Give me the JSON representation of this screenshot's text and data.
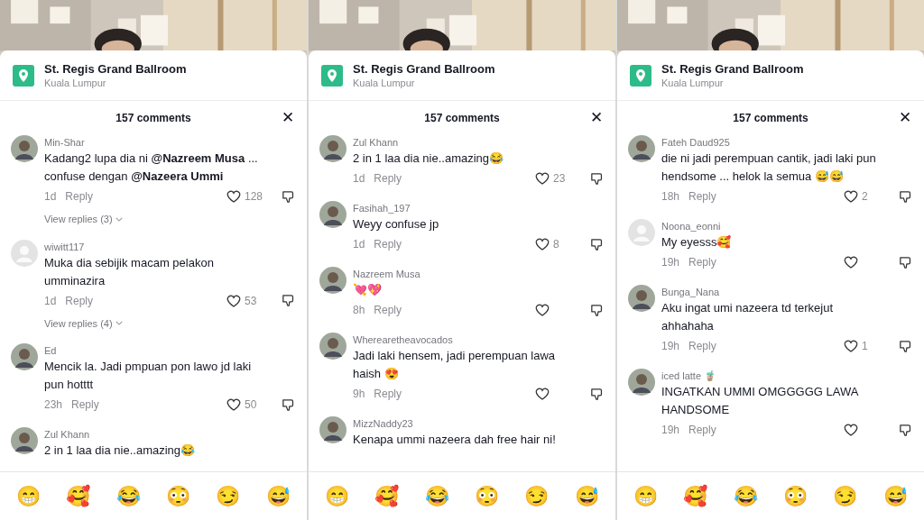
{
  "panels": [
    {
      "location": {
        "name": "St. Regis Grand Ballroom",
        "city": "Kuala Lumpur"
      },
      "comment_count": "157 comments",
      "close": "✕",
      "comments": [
        {
          "user": "Min-Shar",
          "text": "Kadang2 lupa dia ni **@Nazreem Musa** ... confuse dengan **@Nazeera Ummi**",
          "time": "1d",
          "reply": "Reply",
          "likes": "128",
          "view_replies": "View replies (3)"
        },
        {
          "user": "wiwitt117",
          "avatar": {
            "kind": "default"
          },
          "text": "Muka dia sebijik macam pelakon umminazira",
          "time": "1d",
          "reply": "Reply",
          "likes": "53",
          "view_replies": "View replies (4)"
        },
        {
          "user": "Ed",
          "text": "Mencik la. Jadi pmpuan pon lawo jd laki pun hotttt",
          "time": "23h",
          "reply": "Reply",
          "likes": "50"
        },
        {
          "user": "Zul Khann",
          "text": "2 in 1 laa dia nie..amazing😂"
        }
      ],
      "reactions": [
        "😁",
        "🥰",
        "😂",
        "😳",
        "😏",
        "😅"
      ]
    },
    {
      "location": {
        "name": "St. Regis Grand Ballroom",
        "city": "Kuala Lumpur"
      },
      "comment_count": "157 comments",
      "close": "✕",
      "comments": [
        {
          "user": "Zul Khann",
          "text": "2 in 1 laa dia nie..amazing😂",
          "time": "1d",
          "reply": "Reply",
          "likes": "23"
        },
        {
          "user": "Fasihah_197",
          "text": "Weyy confuse jp",
          "time": "1d",
          "reply": "Reply",
          "likes": "8"
        },
        {
          "user": "Nazreem Musa",
          "text": "💘💖",
          "time": "8h",
          "reply": "Reply"
        },
        {
          "user": "Wherearetheavocados",
          "text": "Jadi laki hensem, jadi perempuan lawa haish 😍",
          "time": "9h",
          "reply": "Reply"
        },
        {
          "user": "MizzNaddy23",
          "text": "Kenapa ummi nazeera dah free hair ni!"
        }
      ],
      "reactions": [
        "😁",
        "🥰",
        "😂",
        "😳",
        "😏",
        "😅"
      ]
    },
    {
      "location": {
        "name": "St. Regis Grand Ballroom",
        "city": "Kuala Lumpur"
      },
      "comment_count": "157 comments",
      "close": "✕",
      "comments": [
        {
          "user": "Fateh Daud925",
          "text": "die ni jadi perempuan cantik, jadi laki pun hendsome ... helok la semua 😅😅",
          "time": "18h",
          "reply": "Reply",
          "likes": "2"
        },
        {
          "user": "Noona_eonni",
          "avatar": {
            "kind": "default"
          },
          "text": "My eyesss🥰",
          "time": "19h",
          "reply": "Reply"
        },
        {
          "user": "Bunga_Nana",
          "text": "Aku ingat umi nazeera td terkejut ahhahaha",
          "time": "19h",
          "reply": "Reply",
          "likes": "1"
        },
        {
          "user": "iced latte 🧋",
          "text": "INGATKAN UMMI OMGGGGG LAWA HANDSOME",
          "time": "19h",
          "reply": "Reply"
        }
      ],
      "reactions": [
        "😁",
        "🥰",
        "😂",
        "😳",
        "😏",
        "😅"
      ]
    }
  ]
}
